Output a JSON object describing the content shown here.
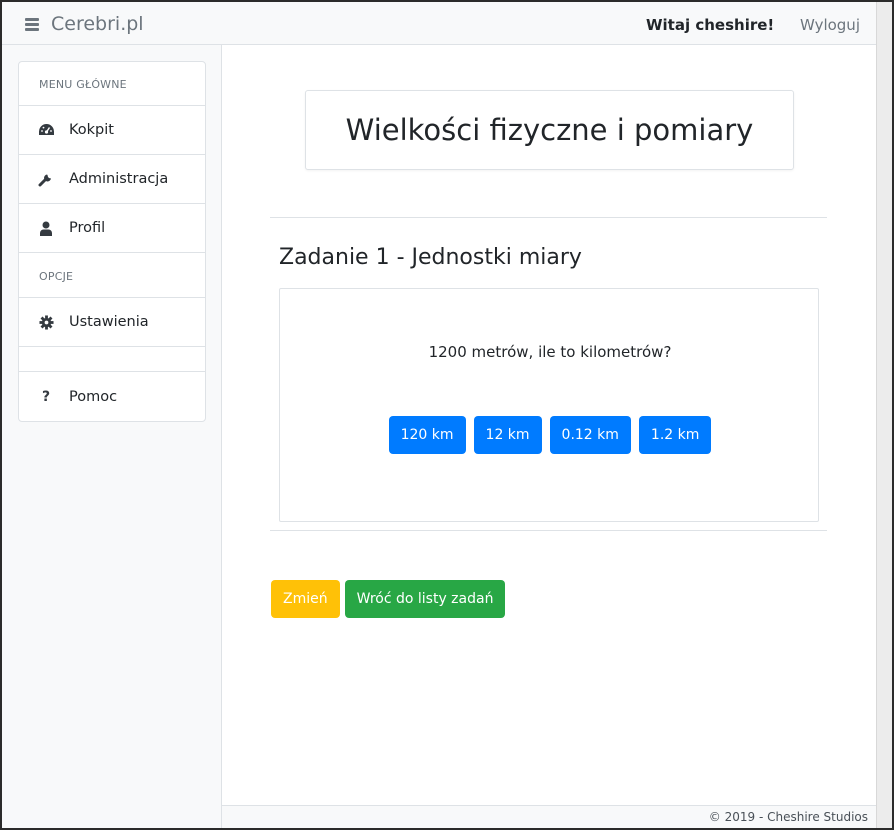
{
  "navbar": {
    "brand": "Cerebri.pl",
    "welcome": "Witaj cheshire!",
    "logout": "Wyloguj"
  },
  "sidebar": {
    "main_header": "MENU GŁÓWNE",
    "items": [
      {
        "label": "Kokpit",
        "icon": "dashboard-icon"
      },
      {
        "label": "Administracja",
        "icon": "wrench-icon"
      },
      {
        "label": "Profil",
        "icon": "user-icon"
      }
    ],
    "options_header": "OPCJE",
    "options_items": [
      {
        "label": "Ustawienia",
        "icon": "gear-icon"
      }
    ],
    "help": {
      "label": "Pomoc",
      "icon": "question-icon"
    }
  },
  "main": {
    "page_title": "Wielkości fizyczne i pomiary",
    "task_title": "Zadanie 1 - Jednostki miary",
    "question": "1200 metrów, ile to kilometrów?",
    "answers": [
      "120 km",
      "12 km",
      "0.12 km",
      "1.2 km"
    ],
    "change_button": "Zmień",
    "back_button": "Wróć do listy zadań"
  },
  "footer": {
    "text": "© 2019 - Cheshire Studios"
  },
  "colors": {
    "primary": "#007bff",
    "warning": "#ffc107",
    "success": "#28a745"
  }
}
